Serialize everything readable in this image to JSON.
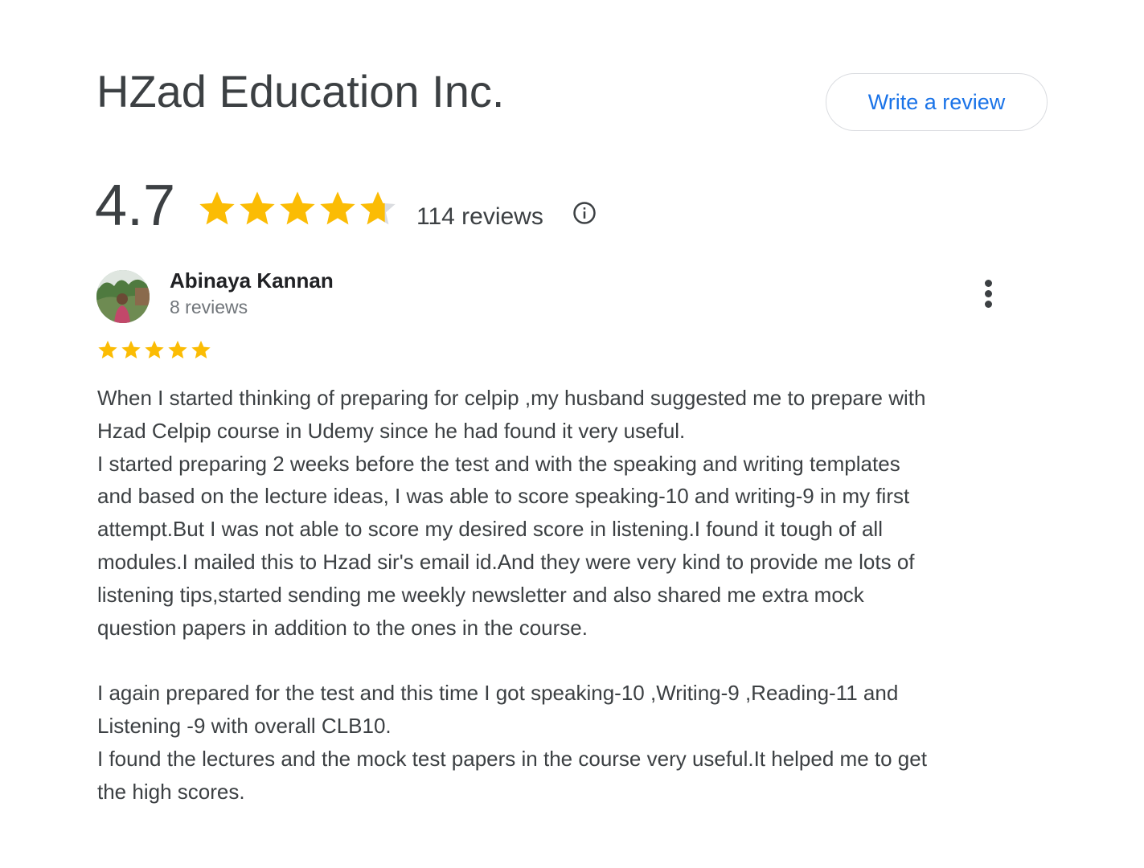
{
  "business": {
    "name": "HZad Education Inc.",
    "write_review_label": "Write a review"
  },
  "rating": {
    "value": "4.7",
    "stars_filled": 4.7,
    "stars_total": 5,
    "reviews_label": "114 reviews",
    "star_color": "#fbbc04",
    "star_empty_color": "#dadce0"
  },
  "review": {
    "author": "Abinaya Kannan",
    "author_reviews": "8 reviews",
    "rating": 5,
    "text_lines": [
      "When I started thinking of preparing for celpip ,my husband suggested me to prepare with",
      "Hzad Celpip course in Udemy since he had found it very useful.",
      "I started preparing 2 weeks before the test and with the speaking and writing templates",
      "and based on the lecture ideas, I was able to score speaking-10 and writing-9 in my first",
      "attempt.But I was not able to score my desired score in listening.I found it tough of all",
      "modules.I mailed this to Hzad sir's email id.And they were very kind to provide me lots of",
      "listening tips,started sending me weekly newsletter and also shared me extra mock",
      "question papers in addition to the ones in the course.",
      "",
      "I again prepared for the test and this time I got speaking-10 ,Writing-9 ,Reading-11 and",
      "Listening -9 with overall CLB10.",
      "I found the lectures and the mock test papers in the course very useful.It helped me to get",
      "the high scores."
    ]
  },
  "icons": {
    "info": "info-circle-icon",
    "more": "more-vertical-icon",
    "star": "star-icon"
  },
  "colors": {
    "link_blue": "#1a73e8",
    "text_primary": "#3c4043",
    "text_secondary": "#70757a"
  }
}
